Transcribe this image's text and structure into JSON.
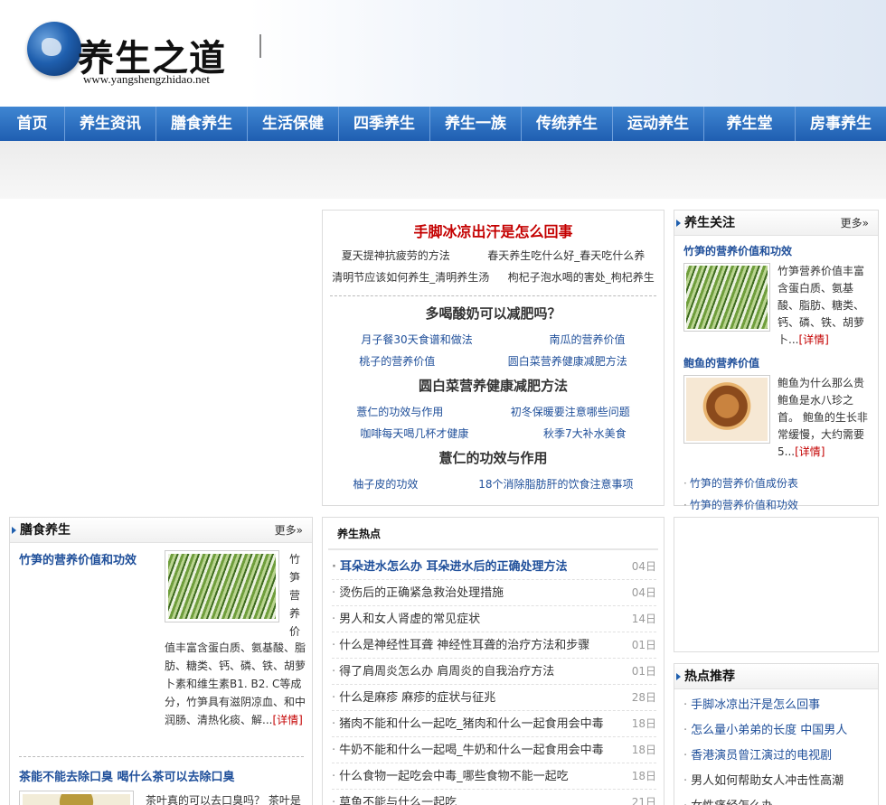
{
  "header": {
    "logo_title": "养生之道",
    "logo_url": "www.yangshengzhidao.net"
  },
  "nav": [
    "首页",
    "养生资讯",
    "膳食养生",
    "生活保健",
    "四季养生",
    "养生一族",
    "传统养生",
    "运动养生",
    "养生堂",
    "房事养生"
  ],
  "center_top": {
    "headline": "手脚冰凉出汗是怎么回事",
    "row1": [
      "夏天提神抗疲劳的方法",
      "春天养生吃什么好_春天吃什么养"
    ],
    "row2": [
      "清明节应该如何养生_清明养生汤",
      "枸杞子泡水喝的害处_枸杞养生"
    ],
    "h2": "多喝酸奶可以减肥吗？",
    "row3": [
      "月子餐30天食谱和做法",
      "南瓜的营养价值"
    ],
    "row4": [
      "桃子的营养价值",
      "圆白菜营养健康减肥方法"
    ],
    "h3": "圆白菜营养健康减肥方法",
    "row5": [
      "薏仁的功效与作用",
      "初冬保暖要注意哪些问题"
    ],
    "row6": [
      "咖啡每天喝几杯才健康",
      "秋季7大补水美食"
    ],
    "h4": "薏仁的功效与作用",
    "row7": [
      "柚子皮的功效",
      "18个消除脂肪肝的饮食注意事项"
    ]
  },
  "right_top": {
    "title": "养生关注",
    "more": "更多»",
    "item1_title": "竹笋的营养价值和功效",
    "item1_desc": "竹笋营养价值丰富含蛋白质、氨基酸、脂肪、糖类、钙、磷、铁、胡萝卜...",
    "item2_title": "鲍鱼的营养价值",
    "item2_desc": "鲍鱼为什么那么贵鲍鱼是水八珍之首。 鲍鱼的生长非常缓慢，大约需要5...",
    "detail": "[详情]",
    "list": [
      "竹笋的营养价值成份表",
      "竹笋的营养价值和功效"
    ]
  },
  "left": {
    "title": "膳食养生",
    "more": "更多»",
    "item1_title": "竹笋的营养价值和功效",
    "item1_vert": "竹笋营养价",
    "item1_desc": "值丰富含蛋白质、氨基酸、脂肪、糖类、钙、磷、铁、胡萝卜素和维生素B1. B2. C等成分，竹笋具有滋阴凉血、和中润肠、清热化痰、解...",
    "detail": "[详情]",
    "item2_title": "茶能不能去除口臭 喝什么茶可以去除口臭",
    "item2_desc": "茶叶真的可以去口臭吗？ 茶叶是"
  },
  "hot": {
    "title": "养生热点",
    "items": [
      {
        "t": "耳朵进水怎么办 耳朵进水后的正确处理方法",
        "d": "04日"
      },
      {
        "t": "烫伤后的正确紧急救治处理措施",
        "d": "04日"
      },
      {
        "t": "男人和女人肾虚的常见症状",
        "d": "14日"
      },
      {
        "t": "什么是神经性耳聋 神经性耳聋的治疗方法和步骤",
        "d": "01日"
      },
      {
        "t": "得了肩周炎怎么办 肩周炎的自我治疗方法",
        "d": "01日"
      },
      {
        "t": "什么是麻疹 麻疹的症状与征兆",
        "d": "28日"
      },
      {
        "t": "猪肉不能和什么一起吃_猪肉和什么一起食用会中毒",
        "d": "18日"
      },
      {
        "t": "牛奶不能和什么一起喝_牛奶和什么一起食用会中毒",
        "d": "18日"
      },
      {
        "t": "什么食物一起吃会中毒_哪些食物不能一起吃",
        "d": "18日"
      },
      {
        "t": "草鱼不能与什么一起吃",
        "d": "21日"
      }
    ]
  },
  "rec": {
    "title": "热点推荐",
    "items": [
      "手脚冰凉出汗是怎么回事",
      "怎么量小弟弟的长度 中国男人",
      "香港演员曾江演过的电视剧",
      "男人如何帮助女人冲击性高潮",
      "女性痛经怎么办"
    ]
  },
  "colors": {
    "nav": "#2f73c4",
    "link": "#1f4f9a",
    "accent": "#c40000"
  }
}
